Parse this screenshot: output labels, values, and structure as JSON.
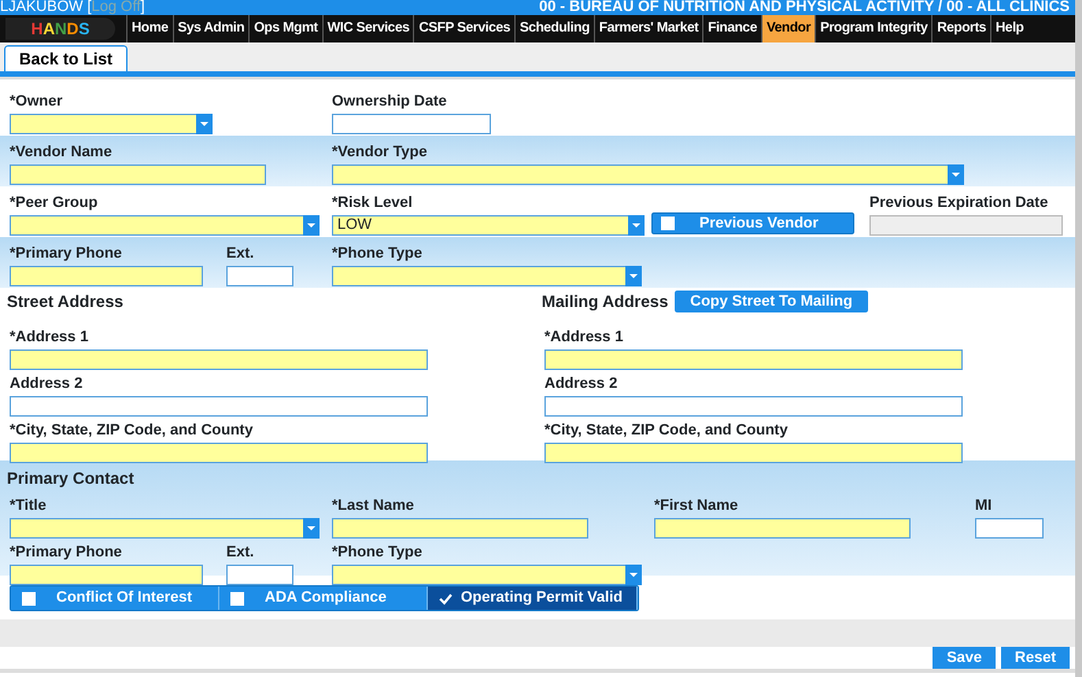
{
  "header": {
    "user": "LJAKUBOW [",
    "logoff_link": "Log Off",
    "closing": "]",
    "agency": "00 - BUREAU OF NUTRITION AND PHYSICAL ACTIVITY / 00 - ALL CLINICS"
  },
  "logo_text": "HANDS",
  "nav": [
    {
      "label": "Home",
      "selected": false
    },
    {
      "label": "Sys Admin",
      "selected": false
    },
    {
      "label": "Ops Mgmt",
      "selected": false
    },
    {
      "label": "WIC Services",
      "selected": false
    },
    {
      "label": "CSFP Services",
      "selected": false
    },
    {
      "label": "Scheduling",
      "selected": false
    },
    {
      "label": "Farmers' Market",
      "selected": false
    },
    {
      "label": "Finance",
      "selected": false
    },
    {
      "label": "Vendor",
      "selected": true
    },
    {
      "label": "Program Integrity",
      "selected": false
    },
    {
      "label": "Reports",
      "selected": false
    },
    {
      "label": "Help",
      "selected": false
    }
  ],
  "tabs": [
    {
      "label": "Back to List",
      "selected": true
    }
  ],
  "vendor_rows": [
    {
      "shaded": false,
      "fields": [
        {
          "kind": "select",
          "label": "*Owner",
          "required": true,
          "disabled": false
        },
        {
          "kind": "text",
          "label": "Ownership Date",
          "required": false,
          "disabled": false
        }
      ]
    },
    {
      "shaded": true,
      "fields": [
        {
          "kind": "text",
          "label": "*Vendor Name",
          "required": true,
          "disabled": false
        },
        {
          "kind": "select",
          "label": "*Vendor Type",
          "required": true,
          "disabled": false
        }
      ]
    },
    {
      "shaded": false,
      "fields": [
        {
          "kind": "select",
          "label": "*Peer Group",
          "required": true,
          "disabled": false
        },
        {
          "kind": "select",
          "label": "*Risk Level",
          "value": "LOW",
          "required": true,
          "disabled": false
        },
        {
          "kind": "toggle",
          "label": "Previous Vendor",
          "checked": false
        },
        {
          "kind": "text",
          "label": "Previous Expiration Date",
          "required": false,
          "disabled": true
        }
      ]
    },
    {
      "shaded": true,
      "fields": [
        {
          "kind": "text",
          "label": "*Primary Phone",
          "required": true,
          "disabled": false
        },
        {
          "kind": "text",
          "label": "Ext.",
          "required": false,
          "disabled": false
        },
        {
          "kind": "select",
          "label": "*Phone Type",
          "required": true,
          "disabled": false
        }
      ]
    }
  ],
  "addresses": [
    {
      "title": "Street Address",
      "fields": [
        {
          "label": "*Address 1",
          "required": true
        },
        {
          "label": "Address 2",
          "required": false
        },
        {
          "label": "*City, State, ZIP Code, and County",
          "required": true
        }
      ]
    },
    {
      "title": "Mailing Address",
      "button": "Copy Street To Mailing",
      "fields": [
        {
          "label": "*Address 1",
          "required": true
        },
        {
          "label": "Address 2",
          "required": false
        },
        {
          "label": "*City, State, ZIP Code, and County",
          "required": true
        }
      ]
    }
  ],
  "primary_contact": {
    "title": "Primary Contact",
    "rows": [
      {
        "fields": [
          {
            "kind": "select",
            "label": "*Title",
            "required": true,
            "disabled": false
          },
          {
            "kind": "text",
            "label": "*Last Name",
            "required": true,
            "disabled": false
          },
          {
            "kind": "text",
            "label": "*First Name",
            "required": true,
            "disabled": false
          },
          {
            "kind": "text",
            "label": "MI",
            "required": false,
            "disabled": false
          }
        ]
      },
      {
        "fields": [
          {
            "kind": "text",
            "label": "*Primary Phone",
            "required": true,
            "disabled": false
          },
          {
            "kind": "text",
            "label": "Ext.",
            "required": false,
            "disabled": false
          },
          {
            "kind": "select",
            "label": "*Phone Type",
            "required": true,
            "disabled": false
          }
        ]
      }
    ]
  },
  "flags": [
    {
      "label": "Conflict Of Interest",
      "checked": false
    },
    {
      "label": "ADA Compliance",
      "checked": false
    },
    {
      "label": "Operating Permit Valid",
      "checked": true
    }
  ],
  "buttons": [
    "Save",
    "Reset"
  ]
}
